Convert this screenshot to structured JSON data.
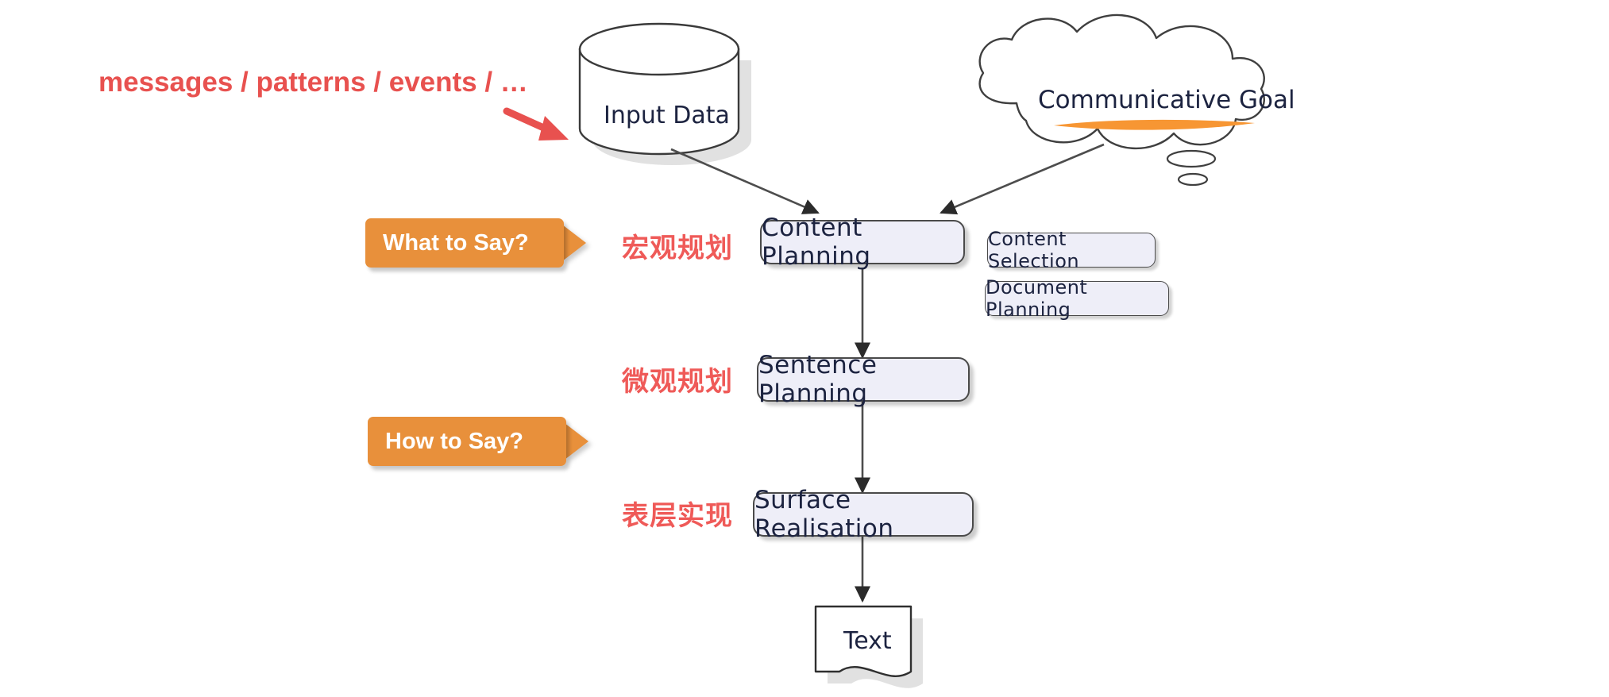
{
  "diagram": {
    "title": "NLG Pipeline Architecture",
    "annotations": {
      "input_note": "messages / patterns / events / …"
    },
    "sources": [
      {
        "id": "input-data",
        "label": "Input Data",
        "shape": "cylinder"
      },
      {
        "id": "communicative-goal",
        "label": "Communicative Goal",
        "shape": "cloud",
        "highlight_color": "#f79633"
      }
    ],
    "callouts": [
      {
        "id": "what-to-say",
        "label": "What  to Say?"
      },
      {
        "id": "how-to-say",
        "label": "How  to Say?"
      }
    ],
    "stage_labels_cn": [
      {
        "id": "macro-planning",
        "label": "宏观规划"
      },
      {
        "id": "micro-planning",
        "label": "微观规划"
      },
      {
        "id": "surface-realisation",
        "label": "表层实现"
      }
    ],
    "stages": [
      {
        "id": "content-planning",
        "label": "Content Planning"
      },
      {
        "id": "sentence-planning",
        "label": "Sentence Planning"
      },
      {
        "id": "surface-realisation",
        "label": "Surface Realisation"
      }
    ],
    "sub_tasks": [
      {
        "id": "content-selection",
        "label": "Content Selection"
      },
      {
        "id": "document-planning",
        "label": "Document Planning"
      }
    ],
    "output": {
      "id": "text-output",
      "label": "Text",
      "shape": "document"
    },
    "colors": {
      "accent_orange": "#e8903b",
      "highlight_orange": "#f79633",
      "annotation_red": "#e8514f",
      "cn_label_red": "#ef5a58",
      "node_fill": "#eeeef8",
      "node_stroke": "#4a4a4a",
      "arrow": "#4d4d4d",
      "text": "#1c2340"
    }
  }
}
